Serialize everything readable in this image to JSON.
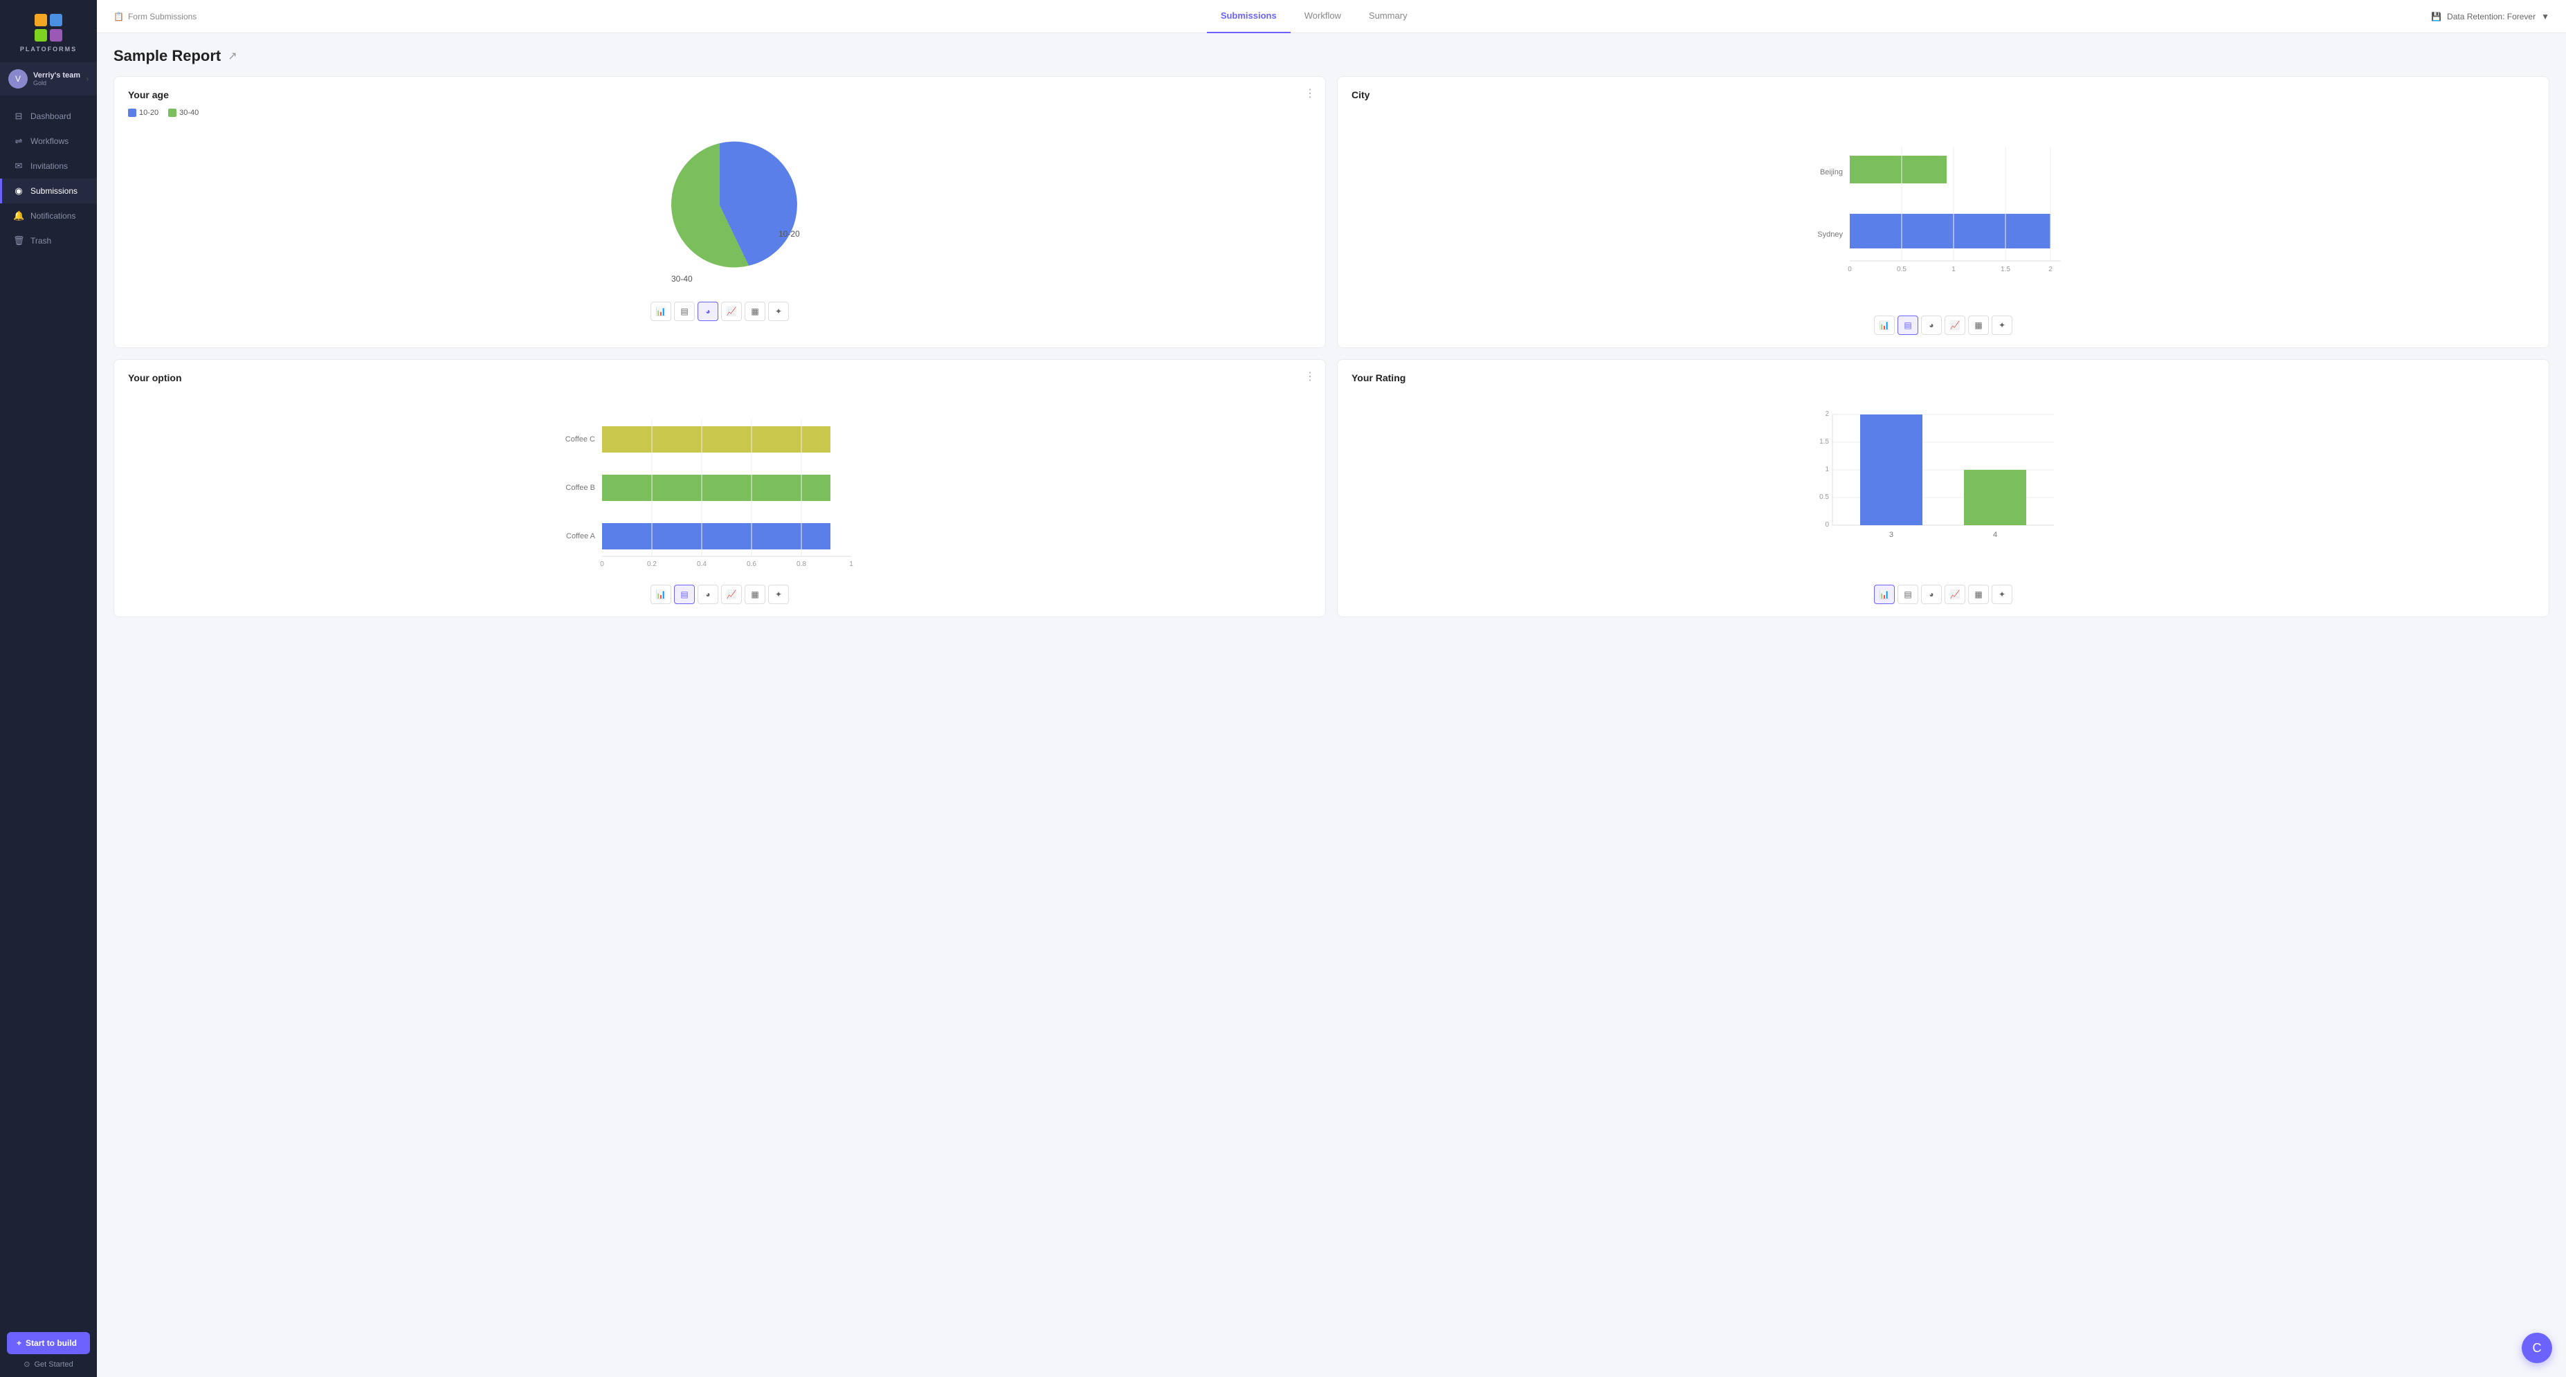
{
  "sidebar": {
    "logo_text": "PLATOFORMS",
    "user": {
      "name": "Verriy's team",
      "plan": "Gold",
      "avatar_letter": "V"
    },
    "nav_items": [
      {
        "id": "dashboard",
        "label": "Dashboard",
        "icon": "⊟",
        "active": false
      },
      {
        "id": "workflows",
        "label": "Workflows",
        "icon": "⇌",
        "active": false
      },
      {
        "id": "invitations",
        "label": "Invitations",
        "icon": "✉",
        "active": false
      },
      {
        "id": "submissions",
        "label": "Submissions",
        "icon": "◉",
        "active": true
      },
      {
        "id": "notifications",
        "label": "Notifications",
        "icon": "🔔",
        "active": false
      },
      {
        "id": "trash",
        "label": "Trash",
        "icon": "🗑",
        "active": false
      }
    ],
    "start_build_label": "Start to build",
    "get_started_label": "Get Started"
  },
  "topnav": {
    "breadcrumb_icon": "📋",
    "breadcrumb_text": "Form Submissions",
    "tabs": [
      {
        "id": "submissions",
        "label": "Submissions",
        "active": true
      },
      {
        "id": "workflow",
        "label": "Workflow",
        "active": false
      },
      {
        "id": "summary",
        "label": "Summary",
        "active": false
      }
    ],
    "data_retention": "Data Retention: Forever"
  },
  "page": {
    "title": "Sample Report",
    "charts": [
      {
        "id": "age",
        "title": "Your age",
        "type": "pie",
        "legend": [
          {
            "label": "10-20",
            "color": "blue"
          },
          {
            "label": "30-40",
            "color": "green"
          }
        ],
        "active_type": 2
      },
      {
        "id": "city",
        "title": "City",
        "type": "bar_horizontal",
        "labels": [
          "Beijing",
          "Sydney"
        ],
        "values": [
          1.0,
          2.0
        ],
        "active_type": 1
      },
      {
        "id": "option",
        "title": "Your option",
        "type": "bar_horizontal",
        "labels": [
          "Coffee C",
          "Coffee B",
          "Coffee A"
        ],
        "values": [
          1.0,
          1.0,
          1.0
        ],
        "colors": [
          "yellow",
          "green",
          "blue"
        ],
        "active_type": 1
      },
      {
        "id": "rating",
        "title": "Your Rating",
        "type": "bar_vertical",
        "labels": [
          "3",
          "4"
        ],
        "values": [
          2.0,
          1.0
        ],
        "active_type": 0
      }
    ]
  },
  "chart_type_buttons": [
    "📊",
    "▤",
    "◕",
    "📈",
    "▦",
    "✦"
  ]
}
